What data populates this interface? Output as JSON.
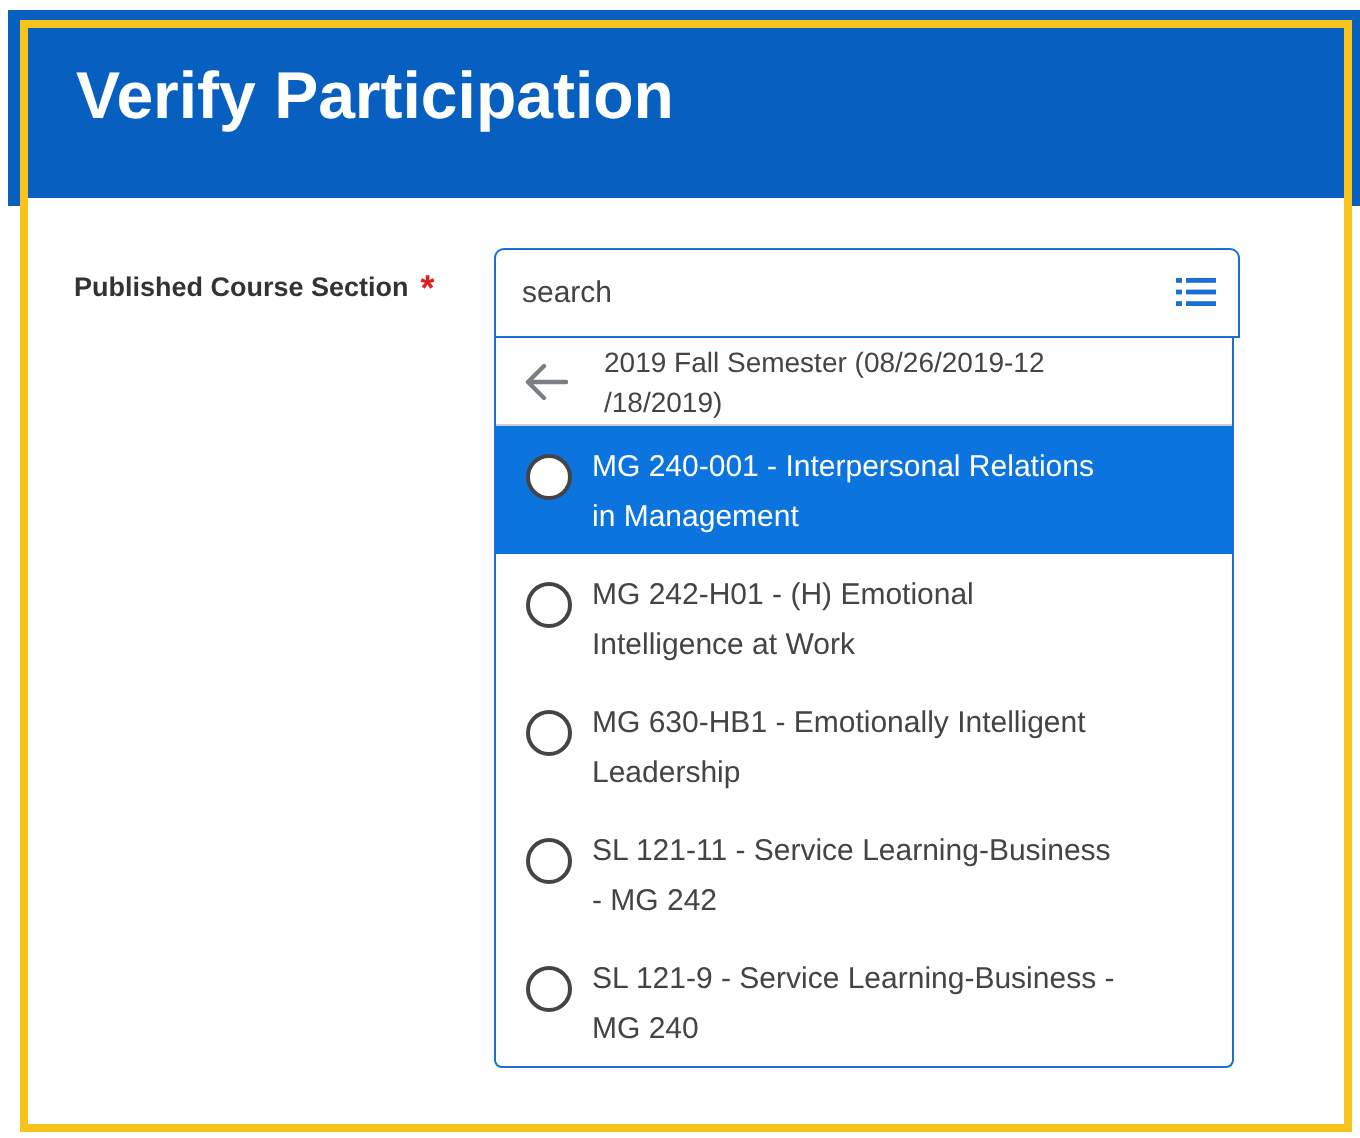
{
  "header": {
    "title": "Verify Participation"
  },
  "field": {
    "label": "Published Course Section",
    "required_mark": "*",
    "placeholder": "search"
  },
  "dropdown": {
    "group": "2019 Fall Semester (08/26/2019-12 /18/2019)",
    "options": [
      {
        "label": "MG 240-001 - Interpersonal Relations in Management",
        "selected": true
      },
      {
        "label": "MG 242-H01 - (H) Emotional Intelligence at Work",
        "selected": false
      },
      {
        "label": "MG 630-HB1 - Emotionally Intelligent Leadership",
        "selected": false
      },
      {
        "label": "SL 121-11 - Service Learning-Business - MG 242",
        "selected": false
      },
      {
        "label": "SL 121-9 - Service Learning-Business - MG 240",
        "selected": false
      }
    ]
  }
}
